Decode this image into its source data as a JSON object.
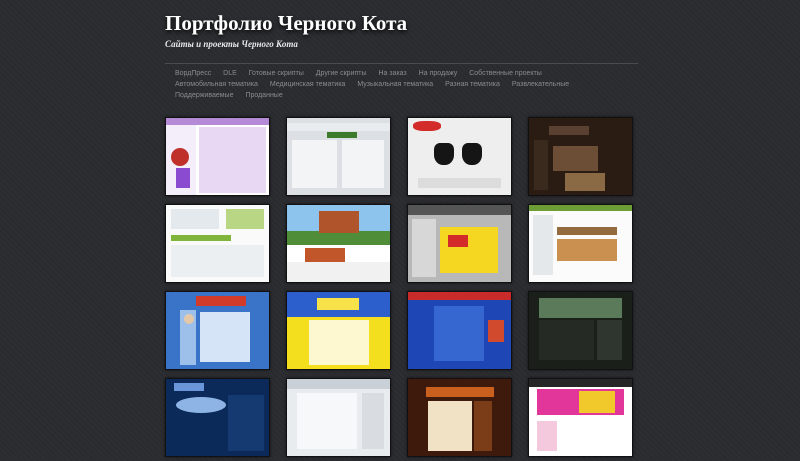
{
  "header": {
    "title": "Портфолио Черного Кота",
    "tagline": "Сайты и проекты Черного Кота"
  },
  "nav": {
    "items": [
      "ВордПресс",
      "DLE",
      "Готовые скрипты",
      "Другие скрипты",
      "На заказ",
      "На продажу",
      "Собственные проекты",
      "Автомобильная тематика",
      "Медицинская тематика",
      "Музыкальная тематика",
      "Разная тематика",
      "Развлекательные",
      "Поддерживаемые",
      "Проданные"
    ]
  },
  "portfolio": {
    "thumbs": [
      {
        "theme": "purple-white"
      },
      {
        "theme": "grey-blue"
      },
      {
        "theme": "hands-black"
      },
      {
        "theme": "black-cat-dark"
      },
      {
        "theme": "white-green"
      },
      {
        "theme": "house-sky"
      },
      {
        "theme": "grey-yellow-red"
      },
      {
        "theme": "shop-white"
      },
      {
        "theme": "blue-portraits"
      },
      {
        "theme": "yellow-blue"
      },
      {
        "theme": "blue-red"
      },
      {
        "theme": "dark-lake"
      },
      {
        "theme": "parnlo-space"
      },
      {
        "theme": "light-grey"
      },
      {
        "theme": "brown-orange"
      },
      {
        "theme": "pink-yellow"
      }
    ]
  }
}
